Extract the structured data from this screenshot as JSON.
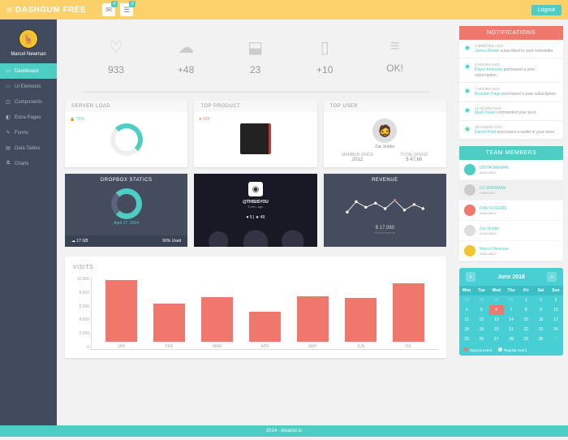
{
  "brand": "DASHGUM FREE",
  "topbar": {
    "badge1": "4",
    "badge2": "3",
    "logout": "Logout"
  },
  "user": {
    "name": "Marcel Newman"
  },
  "nav": [
    {
      "icon": "▭",
      "label": "Dashboard",
      "active": true
    },
    {
      "icon": "▭",
      "label": "UI Elements"
    },
    {
      "icon": "◫",
      "label": "Components"
    },
    {
      "icon": "◧",
      "label": "Extra Pages"
    },
    {
      "icon": "✎",
      "label": "Forms"
    },
    {
      "icon": "▤",
      "label": "Data Tables"
    },
    {
      "icon": "⧉",
      "label": "Charts"
    }
  ],
  "stats": [
    {
      "icon": "♡",
      "value": "933"
    },
    {
      "icon": "☁",
      "value": "+48"
    },
    {
      "icon": "⬓",
      "value": "23"
    },
    {
      "icon": "▯",
      "value": "+10"
    },
    {
      "icon": "≡",
      "value": "OK!"
    }
  ],
  "cards": {
    "serverload": {
      "title": "SERVER LOAD",
      "badge": "70%"
    },
    "topproduct": {
      "title": "TOP PRODUCT",
      "badge": "123"
    },
    "topuser": {
      "title": "TOP USER",
      "name": "Zac Snider",
      "s1l": "MEMBER SINCE",
      "s1v": "2012",
      "s2l": "TOTAL SPEND",
      "s2v": "$ 47,60"
    }
  },
  "dark": {
    "dropbox": {
      "title": "DROPBOX STATICS",
      "date": "April 17, 2014",
      "storage": "17 GB",
      "used": "60% Used"
    },
    "insta": {
      "user": "@THISISYOU",
      "time": "5 min. ago",
      "stats": "♥ 5 | ★ 49"
    },
    "revenue": {
      "title": "REVENUE",
      "amount": "$ 17,980",
      "label": "Month Income"
    }
  },
  "chart_data": {
    "type": "bar",
    "title": "VISITS",
    "categories": [
      "JAN",
      "FEB",
      "MAR",
      "APR",
      "MAY",
      "JUN",
      "JUL"
    ],
    "values": [
      8500,
      5200,
      6100,
      4100,
      6200,
      6000,
      8000
    ],
    "ylim": [
      0,
      10000
    ],
    "yticks": [
      "0",
      "2,000",
      "4,000",
      "6,000",
      "8,000",
      "10,000"
    ]
  },
  "notifications": {
    "title": "NOTIFICATIONS",
    "items": [
      {
        "time": "2 MINUTES AGO",
        "who": "James Brown",
        "text": "subscribed to your newsletter."
      },
      {
        "time": "3 HOURS AGO",
        "who": "Diana Kennedy",
        "text": "purchased a year subscription."
      },
      {
        "time": "7 HOURS AGO",
        "who": "Brandon Page",
        "text": "purchased a year subscription."
      },
      {
        "time": "11 HOURS AGO",
        "who": "Mark Twain",
        "text": "commented your post."
      },
      {
        "time": "18 HOURS AGO",
        "who": "Daniel Pratt",
        "text": "purchased a wallet in your store."
      }
    ]
  },
  "team": {
    "title": "TEAM MEMBERS",
    "members": [
      {
        "name": "DIVYA MANIAN",
        "status": "AVAILABLE",
        "color": "#4ecdc4"
      },
      {
        "name": "DJ SHERMAN",
        "status": "I AM BUSY",
        "busy": true,
        "color": "#ccc"
      },
      {
        "name": "DAN ROGERS",
        "status": "AVAILABLE",
        "color": "#f0776c"
      },
      {
        "name": "Zac Snider",
        "status": "AVAILABLE",
        "color": "#ddd"
      },
      {
        "name": "Marcel Newman",
        "status": "AVAILABLE",
        "color": "#f4c430"
      }
    ]
  },
  "calendar": {
    "month": "June 2018",
    "dow": [
      "Mon",
      "Tue",
      "Wed",
      "Thu",
      "Fri",
      "Sat",
      "Sun"
    ],
    "legend": {
      "special": "Special event",
      "regular": "Regular event"
    }
  },
  "footer": "2014 - Alvarez.is"
}
